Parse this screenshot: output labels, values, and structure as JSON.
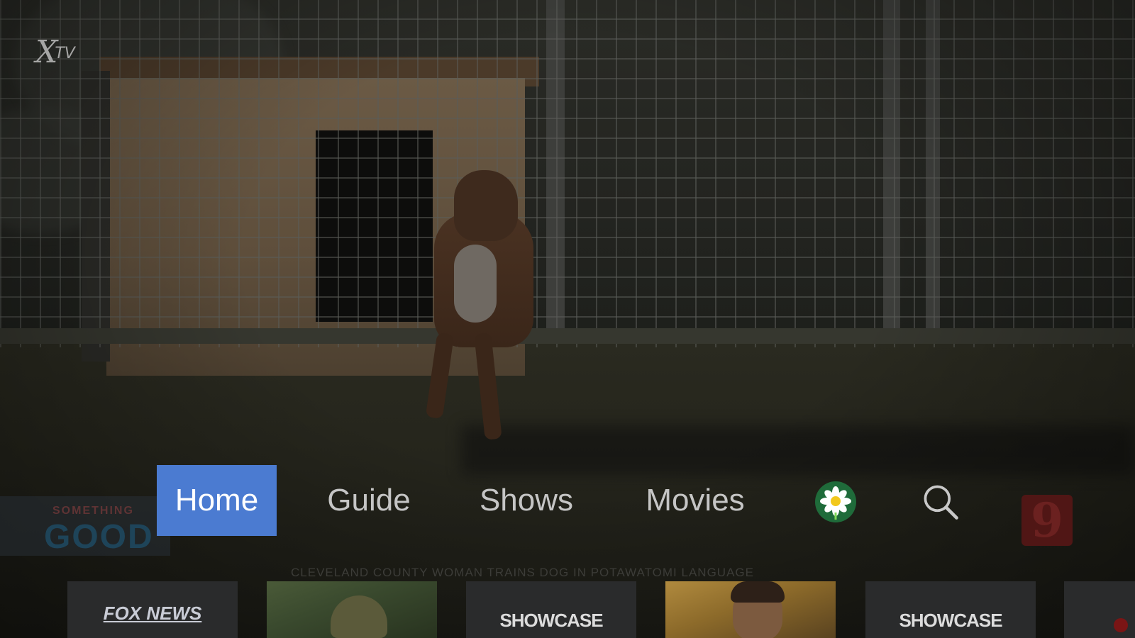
{
  "app": {
    "logo_x": "X",
    "logo_tv": "TV"
  },
  "nav": {
    "items": [
      {
        "label": "Home",
        "active": true
      },
      {
        "label": "Guide",
        "active": false
      },
      {
        "label": "Shows",
        "active": false
      },
      {
        "label": "Movies",
        "active": false
      }
    ],
    "icons": [
      "flower-app-icon",
      "search-icon"
    ]
  },
  "background": {
    "bug_left_small": "SOMETHING",
    "bug_left_big": "GOOD",
    "bug_right_channel": "9",
    "ticker": "CLEVELAND COUNTY WOMAN TRAINS DOG IN POTAWATOMI LANGUAGE"
  },
  "tiles": [
    {
      "kind": "network",
      "label": "FOX NEWS"
    },
    {
      "kind": "poster",
      "label": ""
    },
    {
      "kind": "network",
      "label": "SHOWCASE"
    },
    {
      "kind": "poster",
      "label": ""
    },
    {
      "kind": "network",
      "label": "SHOWCASE"
    }
  ],
  "colors": {
    "active_tab": "#4b7bd1",
    "nav_text": "#c5c5c5",
    "flower_bg": "#1f6b3a"
  }
}
